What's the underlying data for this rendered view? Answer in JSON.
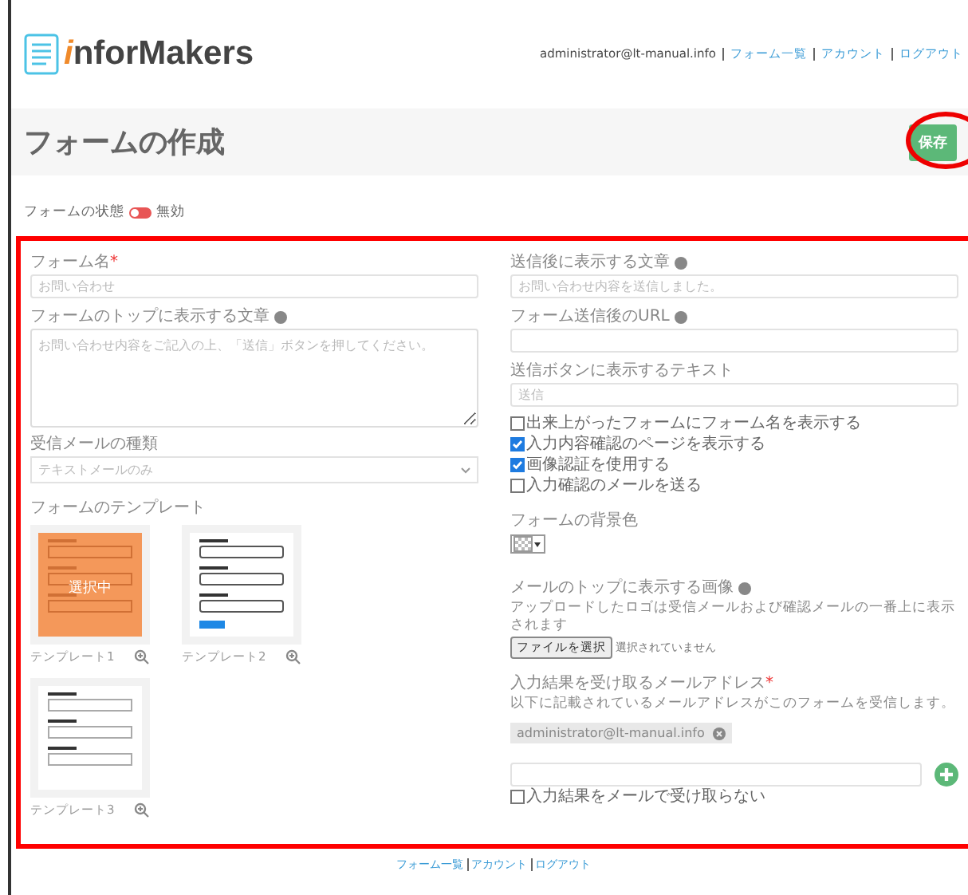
{
  "header": {
    "logo_letter": "i",
    "logo_text": "nforMakers",
    "user": "administrator@lt-manual.info",
    "links": [
      "フォーム一覧",
      "アカウント",
      "ログアウト"
    ]
  },
  "title_bar": {
    "title": "フォームの作成",
    "save_button": "保存"
  },
  "status": {
    "label": "フォームの状態",
    "enabled": false,
    "value": "無効"
  },
  "left": {
    "form_name": {
      "label": "フォーム名",
      "required_mark": "*",
      "placeholder": "お問い合わせ"
    },
    "intro": {
      "label": "フォームのトップに表示する文章",
      "placeholder": "お問い合わせ内容をご記入の上、「送信」ボタンを押してください。"
    },
    "mail_type": {
      "label": "受信メールの種類",
      "value": "テキストメールのみ"
    },
    "templates": {
      "label": "フォームのテンプレート",
      "selected_label": "選択中",
      "items": [
        {
          "label": "テンプレート1",
          "selected": true,
          "kind": "square"
        },
        {
          "label": "テンプレート2",
          "selected": false,
          "kind": "rounded"
        },
        {
          "label": "テンプレート3",
          "selected": false,
          "kind": "square"
        }
      ]
    }
  },
  "right": {
    "after_text": {
      "label": "送信後に表示する文章",
      "placeholder": "お問い合わせ内容を送信しました。"
    },
    "after_url": {
      "label": "フォーム送信後のURL"
    },
    "button_text": {
      "label": "送信ボタンに表示するテキスト",
      "placeholder": "送信"
    },
    "options": [
      {
        "label": "出来上がったフォームにフォーム名を表示する",
        "checked": false
      },
      {
        "label": "入力内容確認のページを表示する",
        "checked": true
      },
      {
        "label": "画像認証を使用する",
        "checked": true
      },
      {
        "label": "入力確認のメールを送る",
        "checked": false
      }
    ],
    "background": {
      "label": "フォームの背景色"
    },
    "mail_image": {
      "label": "メールのトップに表示する画像",
      "hint": "アップロードしたロゴは受信メールおよび確認メールの一番上に表示されます",
      "file_button": "ファイルを選択",
      "file_status": "選択されていません"
    },
    "recipients": {
      "label": "入力結果を受け取るメールアドレス",
      "required_mark": "*",
      "hint": "以下に記載されているメールアドレスがこのフォームを受信します。",
      "addresses": [
        "administrator@lt-manual.info"
      ],
      "no_mail": {
        "label": "入力結果をメールで受け取らない",
        "checked": false
      }
    }
  },
  "footer": {
    "links": [
      "フォーム一覧",
      "アカウント",
      "ログアウト"
    ]
  }
}
